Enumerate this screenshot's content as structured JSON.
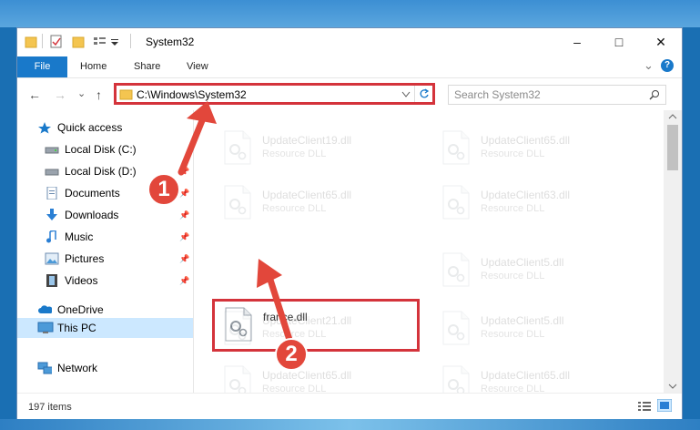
{
  "window": {
    "title": "System32",
    "controls": {
      "minimize": "–",
      "maximize": "□",
      "close": "✕"
    }
  },
  "ribbon": {
    "tabs": [
      "File",
      "Home",
      "Share",
      "View"
    ],
    "chevron": "⌄",
    "help": "?"
  },
  "navigation": {
    "back": "←",
    "forward": "→",
    "recent": "⌄",
    "up": "↑",
    "address": "C:\\Windows\\System32",
    "search_placeholder": "Search System32"
  },
  "sidebar": {
    "quick_access": "Quick access",
    "items": [
      "Local Disk (C:)",
      "Local Disk (D:)",
      "Documents",
      "Downloads",
      "Music",
      "Pictures",
      "Videos"
    ],
    "onedrive": "OneDrive",
    "this_pc": "This PC",
    "network": "Network"
  },
  "files": {
    "left": [
      {
        "name": "UpdateClient19.dll",
        "type": "Resource DLL"
      },
      {
        "name": "UpdateClient65.dll",
        "type": "Resource DLL"
      },
      {
        "name": "france.dll",
        "type": ""
      },
      {
        "name": "UpdateClient21.dll",
        "type": "Resource DLL"
      },
      {
        "name": "UpdateClient65.dll",
        "type": "Resource DLL"
      }
    ],
    "right": [
      {
        "name": "UpdateClient65.dll",
        "type": "Resource DLL"
      },
      {
        "name": "UpdateClient63.dll",
        "type": "Resource DLL"
      },
      {
        "name": "UpdateClient5.dll",
        "type": "Resource DLL"
      },
      {
        "name": "UpdateClient5.dll",
        "type": "Resource DLL"
      },
      {
        "name": "UpdateClient65.dll",
        "type": "Resource DLL"
      }
    ]
  },
  "status": {
    "count": "197 items"
  },
  "callouts": [
    "1",
    "2"
  ],
  "colors": {
    "accent": "#1979ca",
    "highlight": "#d4333b",
    "callout": "#e2473b",
    "selected": "#cce8ff"
  }
}
